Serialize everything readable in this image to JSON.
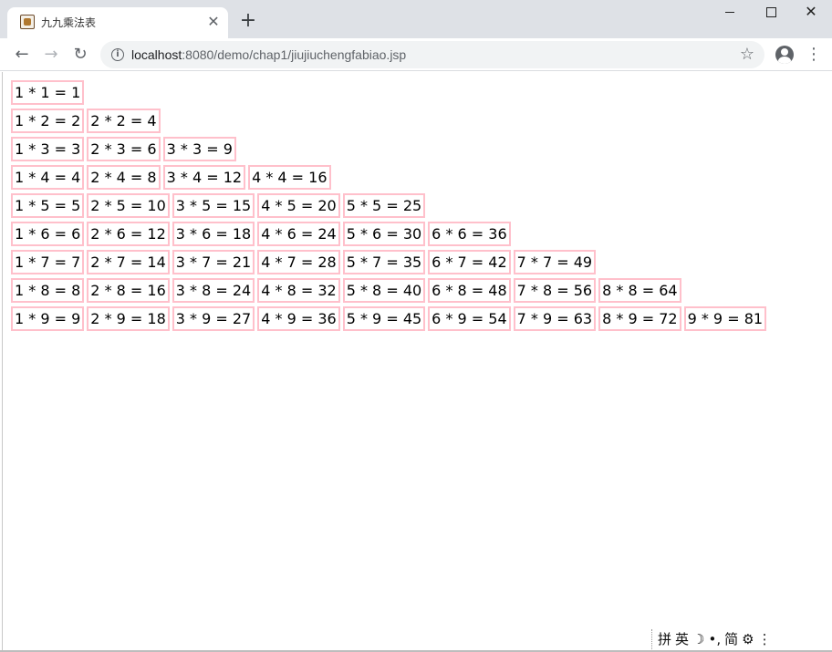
{
  "browser": {
    "tab_title": "九九乘法表",
    "tab_close": "✕",
    "new_tab": "+",
    "window_close": "✕",
    "nav": {
      "back": "←",
      "forward": "→",
      "reload": "↻"
    },
    "url_host": "localhost",
    "url_rest": ":8080/demo/chap1/jiujiuchengfabiao.jsp",
    "info_glyph": "i",
    "star": "☆",
    "menu": "⋮"
  },
  "table": {
    "cell_border_color": "#ffc0cb",
    "rows": [
      [
        "1 * 1 = 1"
      ],
      [
        "1 * 2 = 2",
        "2 * 2 = 4"
      ],
      [
        "1 * 3 = 3",
        "2 * 3 = 6",
        "3 * 3 = 9"
      ],
      [
        "1 * 4 = 4",
        "2 * 4 = 8",
        "3 * 4 = 12",
        "4 * 4 = 16"
      ],
      [
        "1 * 5 = 5",
        "2 * 5 = 10",
        "3 * 5 = 15",
        "4 * 5 = 20",
        "5 * 5 = 25"
      ],
      [
        "1 * 6 = 6",
        "2 * 6 = 12",
        "3 * 6 = 18",
        "4 * 6 = 24",
        "5 * 6 = 30",
        "6 * 6 = 36"
      ],
      [
        "1 * 7 = 7",
        "2 * 7 = 14",
        "3 * 7 = 21",
        "4 * 7 = 28",
        "5 * 7 = 35",
        "6 * 7 = 42",
        "7 * 7 = 49"
      ],
      [
        "1 * 8 = 8",
        "2 * 8 = 16",
        "3 * 8 = 24",
        "4 * 8 = 32",
        "5 * 8 = 40",
        "6 * 8 = 48",
        "7 * 8 = 56",
        "8 * 8 = 64"
      ],
      [
        "1 * 9 = 9",
        "2 * 9 = 18",
        "3 * 9 = 27",
        "4 * 9 = 36",
        "5 * 9 = 45",
        "6 * 9 = 54",
        "7 * 9 = 63",
        "8 * 9 = 72",
        "9 * 9 = 81"
      ]
    ]
  },
  "ime": {
    "items": [
      "拼",
      "英",
      "☽",
      "•,",
      "简",
      "⚙",
      "⋮"
    ]
  }
}
